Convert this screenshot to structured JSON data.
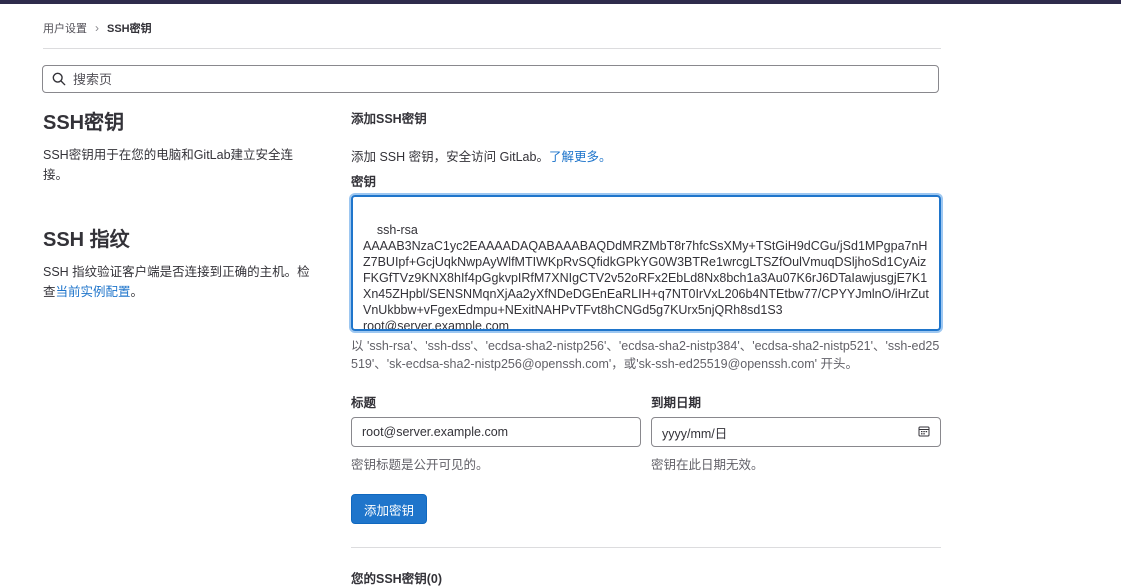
{
  "breadcrumb": {
    "parent": "用户设置",
    "separator": "›",
    "current": "SSH密钥"
  },
  "search": {
    "placeholder": "搜索页"
  },
  "sections": {
    "ssh_keys": {
      "heading": "SSH密钥",
      "description": "SSH密钥用于在您的电脑和GitLab建立安全连接。"
    },
    "ssh_fingerprint": {
      "heading": "SSH 指纹",
      "description": "SSH 指纹验证客户端是否连接到正确的主机。检查",
      "link": "当前实例配置",
      "suffix": "。"
    }
  },
  "form": {
    "title": "添加SSH密钥",
    "description": "添加 SSH 密钥，安全访问 GitLab。",
    "learn_more": "了解更多。",
    "key_label": "密钥",
    "key_value": "ssh-rsa\nAAAAB3NzaC1yc2EAAAADAQABAAABAQDdMRZMbT8r7hfcSsXMy+TStGiH9dCGu/jSd1MPgpa7nHZ7BUIpf+GcjUqkNwpAyWlfMTIWKpRvSQfidkGPkYG0W3BTRe1wrcgLTSZfOulVmuqDSljhoSd1CyAizFKGfTVz9KNX8hIf4pGgkvpIRfM7XNIgCTV2v52oRFx2EbLd8Nx8bch1a3Au07K6rJ6DTaIawjusgjE7K1Xn45ZHpbl/SENSNMqnXjAa2yXfNDeDGEnEaRLIH+q7NT0IrVxL206b4NTEtbw77/CPYYJmlnO/iHrZutVnUkbbw+vFgexEdmpu+NExitNAHPvTFvt8hCNGd5g7KUrx5njQRh8sd1S3\nroot@server.example.com",
    "key_help": "以 'ssh-rsa'、'ssh-dss'、'ecdsa-sha2-nistp256'、'ecdsa-sha2-nistp384'、'ecdsa-sha2-nistp521'、'ssh-ed25519'、'sk-ecdsa-sha2-nistp256@openssh.com'，或'sk-ssh-ed25519@openssh.com' 开头。",
    "title_label": "标题",
    "title_value": "root@server.example.com",
    "title_help": "密钥标题是公开可见的。",
    "expiry_label": "到期日期",
    "expiry_value": "yyyy/mm/日",
    "expiry_help": "密钥在此日期无效。",
    "submit_label": "添加密钥"
  },
  "your_keys": {
    "heading": "您的SSH密钥(0)"
  },
  "colors": {
    "accent": "#1f75cb",
    "topbar": "#2e2b4c",
    "border": "#89888d"
  },
  "icons": {
    "search": "search-icon",
    "calendar": "calendar-icon",
    "resize": "resize-grip-icon"
  }
}
